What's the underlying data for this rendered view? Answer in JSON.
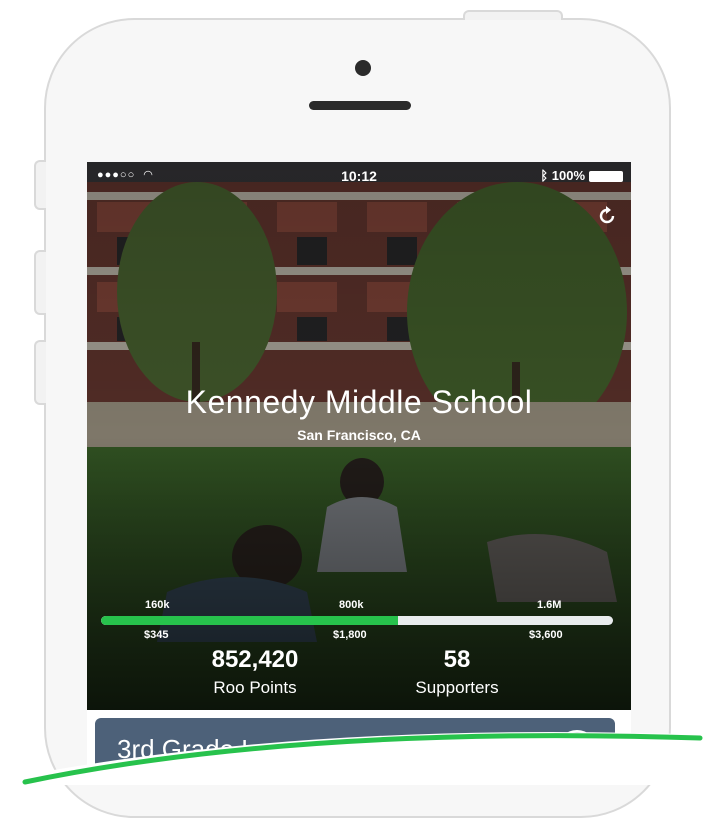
{
  "status_bar": {
    "signal": "●●●○○",
    "time": "10:12",
    "battery": "100%"
  },
  "hero": {
    "school_name": "Kennedy Middle School",
    "location": "San Francisco, CA"
  },
  "progress": {
    "fraction": 0.58,
    "milestones_points": [
      "160k",
      "800k",
      "1.6M"
    ],
    "milestones_dollars": [
      "$345",
      "$1,800",
      "$3,600"
    ]
  },
  "stats": {
    "roo_points_value": "852,420",
    "roo_points_label": "Roo Points",
    "supporters_value": "58",
    "supporters_label": "Supporters"
  },
  "card": {
    "title": "3rd Grade L"
  },
  "colors": {
    "progress_fill": "#27c24c",
    "card_bg": "#4d6179",
    "swoosh_green": "#27c24c"
  },
  "icons": {
    "refresh": "refresh-icon",
    "wifi": "wifi-icon",
    "bluetooth": "bluetooth-icon",
    "card": "target-icon"
  }
}
